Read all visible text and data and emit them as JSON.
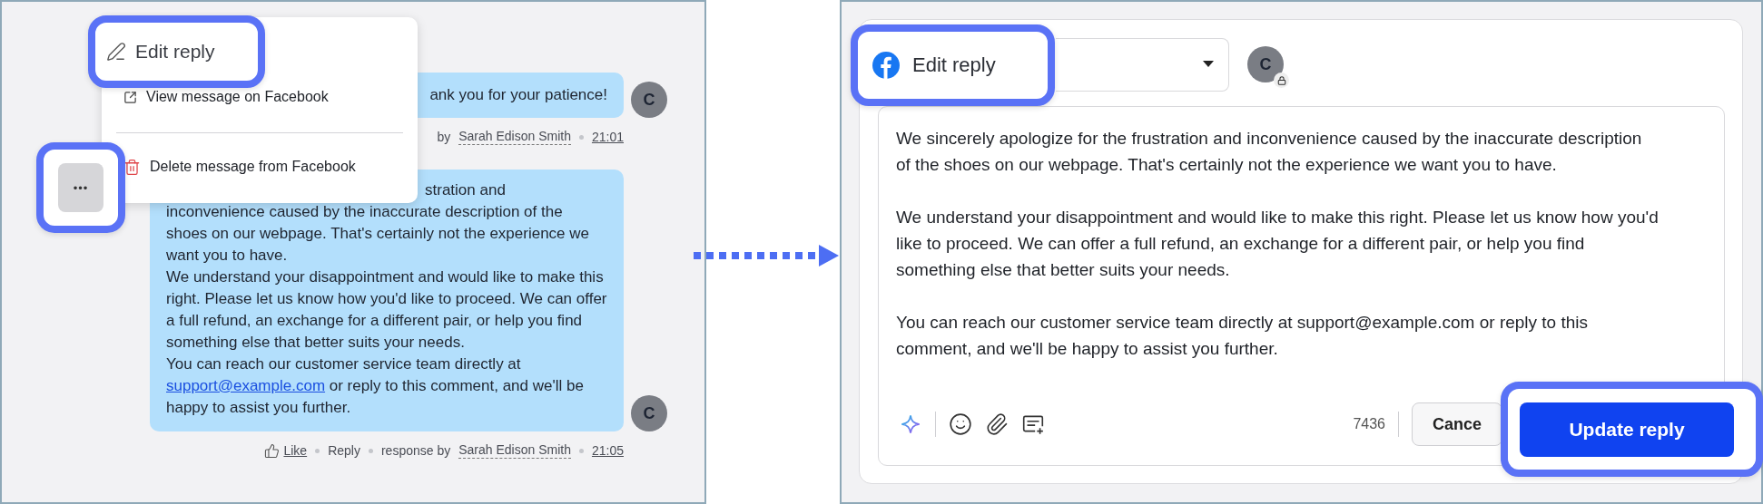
{
  "conversation": {
    "menu": {
      "items": [
        {
          "kind": "edit",
          "label": "Edit reply",
          "callout": true
        },
        {
          "kind": "open",
          "label": "View message on Facebook",
          "callout": false
        },
        {
          "kind": "delete",
          "label": "Delete message from Facebook",
          "callout": false
        }
      ]
    },
    "more_button": {
      "label": "•••",
      "callout": true
    },
    "messages": [
      {
        "paragraphs": [
          {
            "text": "ank you for your patience!"
          }
        ],
        "avatar": "C",
        "meta": [
          {
            "kind": "text",
            "text": "by"
          },
          {
            "kind": "author",
            "text": "Sarah Edison Smith"
          },
          {
            "kind": "time",
            "text": "21:01"
          }
        ]
      },
      {
        "paragraphs": [
          {
            "text": "stration and inconvenience caused by the inaccurate description of the shoes on our webpage. That's certainly not the experience we want you to have."
          },
          {
            "text": "We understand your disappointment and would like to make this right. Please let us know how you'd like to proceed. We can offer a full refund, an exchange for a different pair, or help you find something else that better suits your needs."
          },
          {
            "text": "You can reach our customer service team directly at ",
            "link": "support@example.com",
            "after": " or reply to this comment, and we'll be happy to assist you further."
          }
        ],
        "avatar": "C",
        "meta": [
          {
            "kind": "like",
            "text": "Like"
          },
          {
            "kind": "action",
            "text": "Reply"
          },
          {
            "kind": "text",
            "text": "response by"
          },
          {
            "kind": "author",
            "text": "Sarah Edison Smith"
          },
          {
            "kind": "time",
            "text": "21:05"
          }
        ]
      }
    ]
  },
  "editor": {
    "channel": {
      "label": "Edit reply",
      "callout": true
    },
    "avatar": "C",
    "body": [
      "We sincerely apologize for the frustration and inconvenience caused by the inaccurate description of the shoes on our webpage. That's certainly not the experience we want you to have.",
      "We understand your disappointment and would like to make this right. Please let us know how you'd like to proceed. We can offer a full refund, an exchange for a different pair, or help you find something else that better suits your needs.",
      "You can reach our customer service team directly at support@example.com or reply to this comment, and we'll be happy to assist you further."
    ],
    "char_count": "7436",
    "cancel": "Cance",
    "submit": {
      "label": "Update reply",
      "callout": true
    }
  }
}
